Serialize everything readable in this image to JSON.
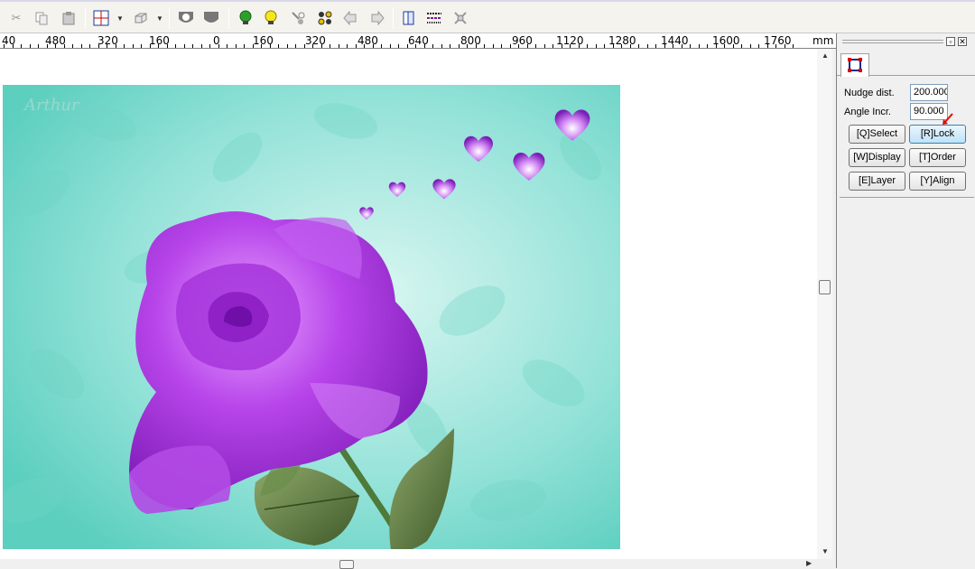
{
  "toolbar": {
    "icons": [
      "cut-icon",
      "copy-icon",
      "paste-icon",
      "snap-icon",
      "view-3d-icon",
      "shape-a-icon",
      "shape-b-icon",
      "bulb-green-icon",
      "bulb-yellow-icon",
      "node-edit-icon",
      "node-group-icon",
      "arrow-left-icon",
      "arrow-right-icon",
      "book-icon",
      "pattern-icon",
      "tools-icon"
    ]
  },
  "ruler": {
    "labels": [
      "40",
      "480",
      "320",
      "160",
      "0",
      "160",
      "320",
      "480",
      "640",
      "800",
      "960",
      "1120",
      "1280",
      "1440",
      "1600",
      "1760"
    ],
    "unit": "mm"
  },
  "panel": {
    "nudge_label": "Nudge dist.",
    "nudge_value": "200.000",
    "angle_label": "Angle Incr.",
    "angle_value": "90.000",
    "buttons": {
      "select": "[Q]Select",
      "lock": "[R]Lock",
      "display": "[W]Display",
      "order": "[T]Order",
      "layer": "[E]Layer",
      "align": "[Y]Align"
    },
    "restore_glyph": "▫",
    "close_glyph": "✕"
  },
  "artwork": {
    "watermark": "Arthur"
  },
  "colors": {
    "accent": "#3c7fb1",
    "teal": "#7fdcd2",
    "purple": "#9b2fd0"
  }
}
